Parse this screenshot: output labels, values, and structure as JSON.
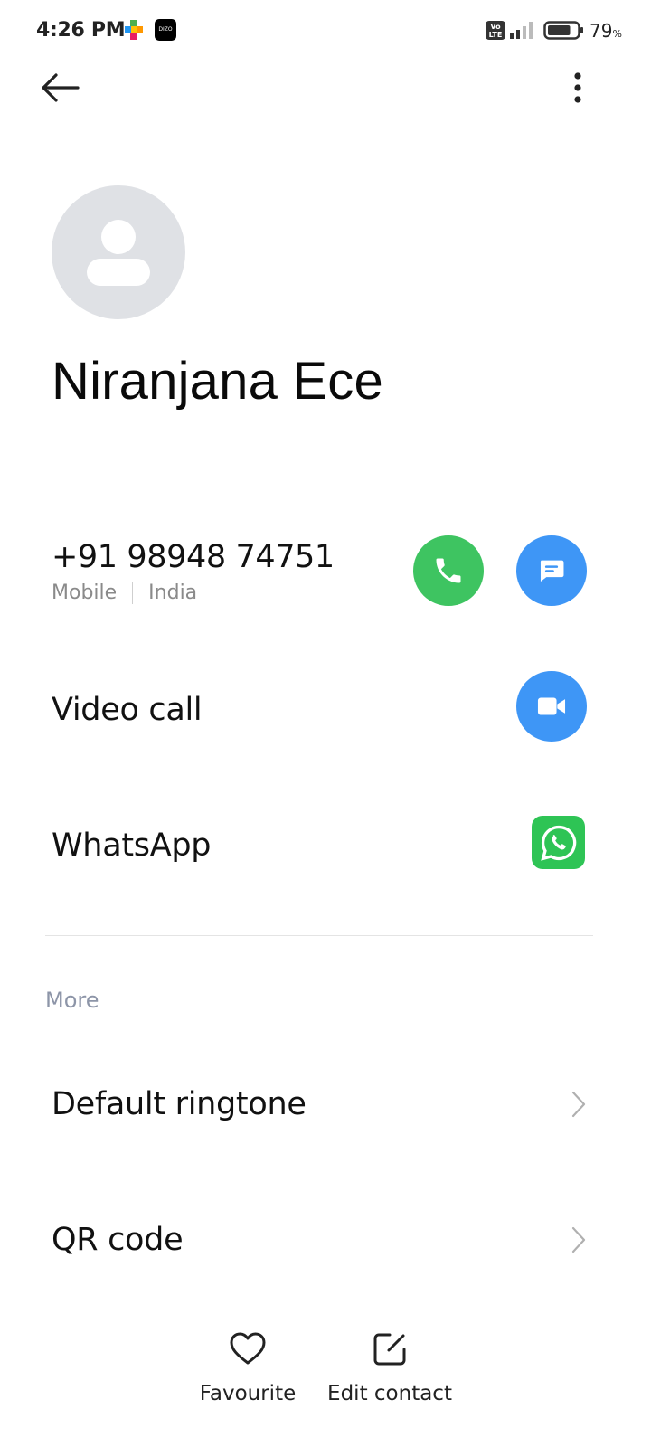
{
  "status_bar": {
    "time": "4:26 PM",
    "notification_icons": [
      "play-services-icon",
      "dizo-icon"
    ],
    "dizo_label": "DIZO",
    "volte_label": "Vo LTE",
    "battery_percent": "79",
    "battery_unit": "%",
    "battery_level": 0.79
  },
  "toolbar": {
    "back_icon": "arrow-left-icon",
    "more_icon": "more-vertical-icon"
  },
  "contact": {
    "name": "Niranjana Ece",
    "avatar_icon": "person-placeholder-icon"
  },
  "phone": {
    "number": "+91 98948 74751",
    "type": "Mobile",
    "country": "India",
    "call_icon": "phone-icon",
    "message_icon": "message-icon"
  },
  "actions": {
    "video_call_label": "Video call",
    "whatsapp_label": "WhatsApp"
  },
  "more_section": {
    "header": "More",
    "items": [
      {
        "label": "Default ringtone"
      },
      {
        "label": "QR code"
      }
    ]
  },
  "bottom_bar": {
    "favourite_label": "Favourite",
    "edit_label": "Edit contact"
  },
  "colors": {
    "call_green": "#3ec461",
    "action_blue": "#3e96f6",
    "whatsapp_green": "#2ec455",
    "avatar_bg": "#dfe1e5",
    "section_header": "#8d95a8"
  }
}
